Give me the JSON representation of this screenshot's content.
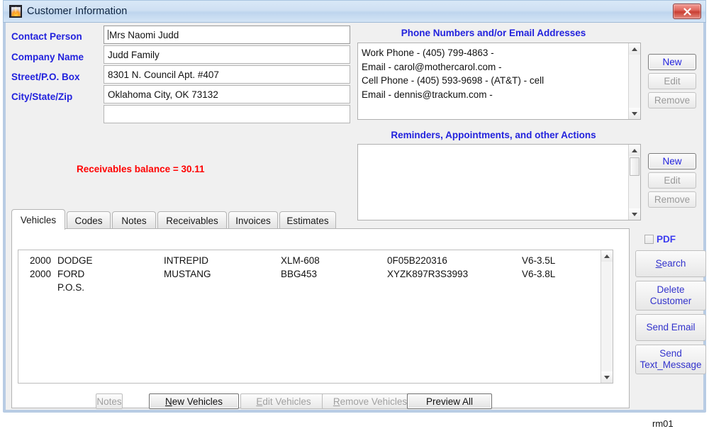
{
  "window": {
    "title": "Customer Information",
    "app_icon": "app-logo-icon",
    "close_label": "close-icon",
    "footer_code": "rm01"
  },
  "form": {
    "fields": [
      {
        "label": "Contact Person",
        "value": "Mrs Naomi Judd",
        "focused": true
      },
      {
        "label": "Company Name",
        "value": "Judd Family",
        "focused": false
      },
      {
        "label": "Street/P.O. Box",
        "value": "8301 N. Council Apt. #407",
        "focused": false
      },
      {
        "label": "City/State/Zip",
        "value": "Oklahoma City, OK 73132",
        "focused": false
      },
      {
        "label": "",
        "value": "",
        "focused": false
      }
    ],
    "balance_text": "Receivables balance = 30.11"
  },
  "phones": {
    "title": "Phone Numbers and/or Email Addresses",
    "entries": [
      "Work Phone - (405) 799-4863 -",
      "Email - carol@mothercarol.com -",
      "Cell Phone - (405) 593-9698 - (AT&T) - cell",
      "Email - dennis@trackum.com -"
    ],
    "buttons": [
      {
        "label": "New",
        "enabled": true
      },
      {
        "label": "Edit",
        "enabled": false
      },
      {
        "label": "Remove",
        "enabled": false
      }
    ]
  },
  "reminders": {
    "title": "Reminders, Appointments, and other Actions",
    "entries": [],
    "buttons": [
      {
        "label": "New",
        "enabled": true
      },
      {
        "label": "Edit",
        "enabled": false
      },
      {
        "label": "Remove",
        "enabled": false
      }
    ]
  },
  "tabs": [
    {
      "label": "Vehicles",
      "active": true
    },
    {
      "label": "Codes",
      "active": false
    },
    {
      "label": "Notes",
      "active": false
    },
    {
      "label": "Receivables",
      "active": false
    },
    {
      "label": "Invoices",
      "active": false
    },
    {
      "label": "Estimates",
      "active": false
    }
  ],
  "vehicles": {
    "rows": [
      {
        "year": "2000",
        "make": "DODGE",
        "model": "INTREPID",
        "plate": "XLM-608",
        "vin": "0F05B220316",
        "engine": "V6-3.5L"
      },
      {
        "year": "2000",
        "make": "FORD",
        "model": "MUSTANG",
        "plate": "BBG453",
        "vin": "XYZK897R3S3993",
        "engine": "V6-3.8L"
      },
      {
        "year": "",
        "make": "P.O.S.",
        "model": "",
        "plate": "",
        "vin": "",
        "engine": ""
      }
    ]
  },
  "bottom_buttons": [
    {
      "label": "Notes",
      "enabled": false,
      "accel": ""
    },
    {
      "label": "New Vehicles",
      "enabled": true,
      "accel": "N"
    },
    {
      "label": "Edit Vehicles",
      "enabled": false,
      "accel": "E"
    },
    {
      "label": "Remove Vehicles",
      "enabled": false,
      "accel": "R"
    },
    {
      "label": "Preview All",
      "enabled": true,
      "accel": ""
    }
  ],
  "actions": {
    "pdf_label": "PDF",
    "pdf_checked": false,
    "buttons": [
      {
        "label": "Search",
        "accel": "S"
      },
      {
        "label": "Delete\nCustomer",
        "accel": ""
      },
      {
        "label": "Send Email",
        "accel": ""
      },
      {
        "label": "Send\nText_Message",
        "accel": ""
      }
    ]
  },
  "colors": {
    "label_blue": "#2222dd",
    "balance_red": "#ff0000",
    "button_blue": "#3333cc",
    "frame_blue": "#b8cce4"
  }
}
